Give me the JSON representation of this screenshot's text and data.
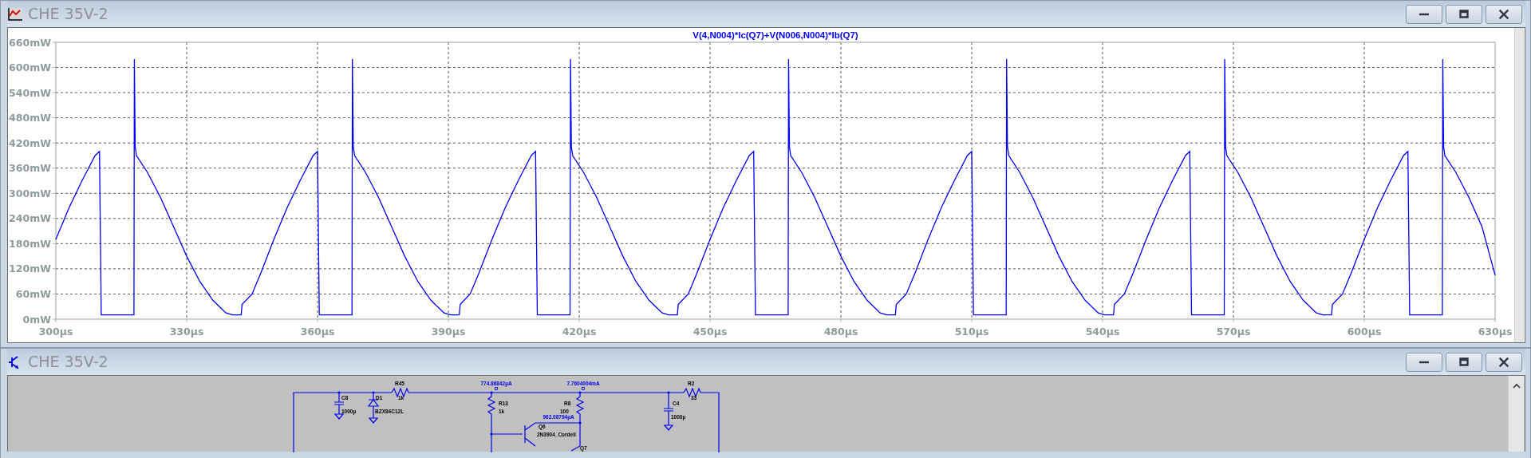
{
  "windows": [
    {
      "kind": "waveform",
      "title": "CHE 35V-2",
      "chart_data": {
        "type": "line",
        "x": [
          300,
          303,
          306,
          309,
          310,
          310.4,
          317.9,
          318,
          318.2,
          318.5,
          321,
          324,
          327,
          330,
          333,
          336,
          339,
          340.5,
          342.5,
          342.7,
          345,
          347,
          350,
          353,
          356,
          359,
          360,
          360.4,
          367.9,
          368,
          368.2,
          368.5,
          371,
          374,
          377,
          380,
          383,
          386,
          389,
          390.5,
          392.5,
          392.7,
          395,
          397,
          400,
          403,
          406,
          409,
          410,
          410.4,
          417.9,
          418,
          418.2,
          418.5,
          421,
          424,
          427,
          430,
          433,
          436,
          439,
          440.5,
          442.5,
          442.7,
          445,
          447,
          450,
          453,
          456,
          459,
          460,
          460.4,
          467.9,
          468,
          468.2,
          468.5,
          471,
          474,
          477,
          480,
          483,
          486,
          489,
          490.5,
          492.5,
          492.7,
          495,
          497,
          500,
          503,
          506,
          509,
          510,
          510.4,
          517.9,
          518,
          518.2,
          518.5,
          521,
          524,
          527,
          530,
          533,
          536,
          539,
          540.5,
          542.5,
          542.7,
          545,
          547,
          550,
          553,
          556,
          559,
          560,
          560.4,
          567.9,
          568,
          568.2,
          568.5,
          571,
          574,
          577,
          580,
          583,
          586,
          589,
          590.5,
          592.5,
          592.7,
          595,
          597,
          600,
          603,
          606,
          609,
          610,
          610.4,
          617.9,
          618,
          618.2,
          618.5,
          621,
          624,
          627,
          630
        ],
        "series": [
          {
            "name": "V(4,N004)*Ic(Q7)+V(N006,N004)*Ib(Q7)",
            "color": "#0000ff",
            "values": [
              190,
              265,
              330,
              390,
              400,
              10,
              10,
              620,
              410,
              390,
              350,
              290,
              220,
              150,
              90,
              45,
              15,
              10,
              10,
              35,
              60,
              110,
              190,
              265,
              330,
              390,
              400,
              10,
              10,
              620,
              410,
              390,
              350,
              290,
              220,
              150,
              90,
              45,
              15,
              10,
              10,
              35,
              60,
              110,
              190,
              265,
              330,
              390,
              400,
              10,
              10,
              620,
              410,
              390,
              350,
              290,
              220,
              150,
              90,
              45,
              15,
              10,
              10,
              35,
              60,
              110,
              190,
              265,
              330,
              390,
              400,
              10,
              10,
              620,
              410,
              390,
              350,
              290,
              220,
              150,
              90,
              45,
              15,
              10,
              10,
              35,
              60,
              110,
              190,
              265,
              330,
              390,
              400,
              10,
              10,
              620,
              410,
              390,
              350,
              290,
              220,
              150,
              90,
              45,
              15,
              10,
              10,
              35,
              60,
              110,
              190,
              265,
              330,
              390,
              400,
              10,
              10,
              620,
              410,
              390,
              350,
              290,
              220,
              150,
              90,
              45,
              15,
              10,
              10,
              35,
              60,
              110,
              190,
              265,
              330,
              390,
              400,
              10,
              10,
              620,
              410,
              390,
              350,
              290,
              220,
              105
            ]
          }
        ],
        "xlim": [
          300,
          630
        ],
        "ylim": [
          0,
          660
        ],
        "grid": true,
        "xticks": [
          {
            "value": 300,
            "label": "300µs"
          },
          {
            "value": 330,
            "label": "330µs"
          },
          {
            "value": 360,
            "label": "360µs"
          },
          {
            "value": 390,
            "label": "390µs"
          },
          {
            "value": 420,
            "label": "420µs"
          },
          {
            "value": 450,
            "label": "450µs"
          },
          {
            "value": 480,
            "label": "480µs"
          },
          {
            "value": 510,
            "label": "510µs"
          },
          {
            "value": 540,
            "label": "540µs"
          },
          {
            "value": 570,
            "label": "570µs"
          },
          {
            "value": 600,
            "label": "600µs"
          },
          {
            "value": 630,
            "label": "630µs"
          }
        ],
        "yticks": [
          {
            "value": 0,
            "label": "0mW"
          },
          {
            "value": 60,
            "label": "60mW"
          },
          {
            "value": 120,
            "label": "120mW"
          },
          {
            "value": 180,
            "label": "180mW"
          },
          {
            "value": 240,
            "label": "240mW"
          },
          {
            "value": 300,
            "label": "300mW"
          },
          {
            "value": 360,
            "label": "360mW"
          },
          {
            "value": 420,
            "label": "420mW"
          },
          {
            "value": 480,
            "label": "480mW"
          },
          {
            "value": 540,
            "label": "540mW"
          },
          {
            "value": 600,
            "label": "600mW"
          },
          {
            "value": 660,
            "label": "660mW"
          }
        ]
      }
    },
    {
      "kind": "schematic",
      "title": "CHE 35V-2",
      "labels": [
        {
          "text": "R45",
          "kind": "part"
        },
        {
          "text": "774.86842µA",
          "kind": "probe"
        },
        {
          "text": "7.7604004mA",
          "kind": "probe"
        },
        {
          "text": "R2",
          "kind": "part"
        },
        {
          "text": "C8",
          "kind": "part"
        },
        {
          "text": "D1",
          "kind": "part"
        },
        {
          "text": "1k",
          "kind": "part"
        },
        {
          "text": "33",
          "kind": "part"
        },
        {
          "text": "R13",
          "kind": "part"
        },
        {
          "text": "R8",
          "kind": "part"
        },
        {
          "text": "C4",
          "kind": "part"
        },
        {
          "text": "1000µ",
          "kind": "part"
        },
        {
          "text": "BZX84C12L",
          "kind": "part"
        },
        {
          "text": "1k",
          "kind": "part"
        },
        {
          "text": "100",
          "kind": "part"
        },
        {
          "text": "962.08794µA",
          "kind": "probe"
        },
        {
          "text": "1000µ",
          "kind": "part"
        },
        {
          "text": "Q6",
          "kind": "part"
        },
        {
          "text": "2N3904_Cordell",
          "kind": "part"
        },
        {
          "text": "Q7",
          "kind": "part"
        }
      ]
    }
  ]
}
